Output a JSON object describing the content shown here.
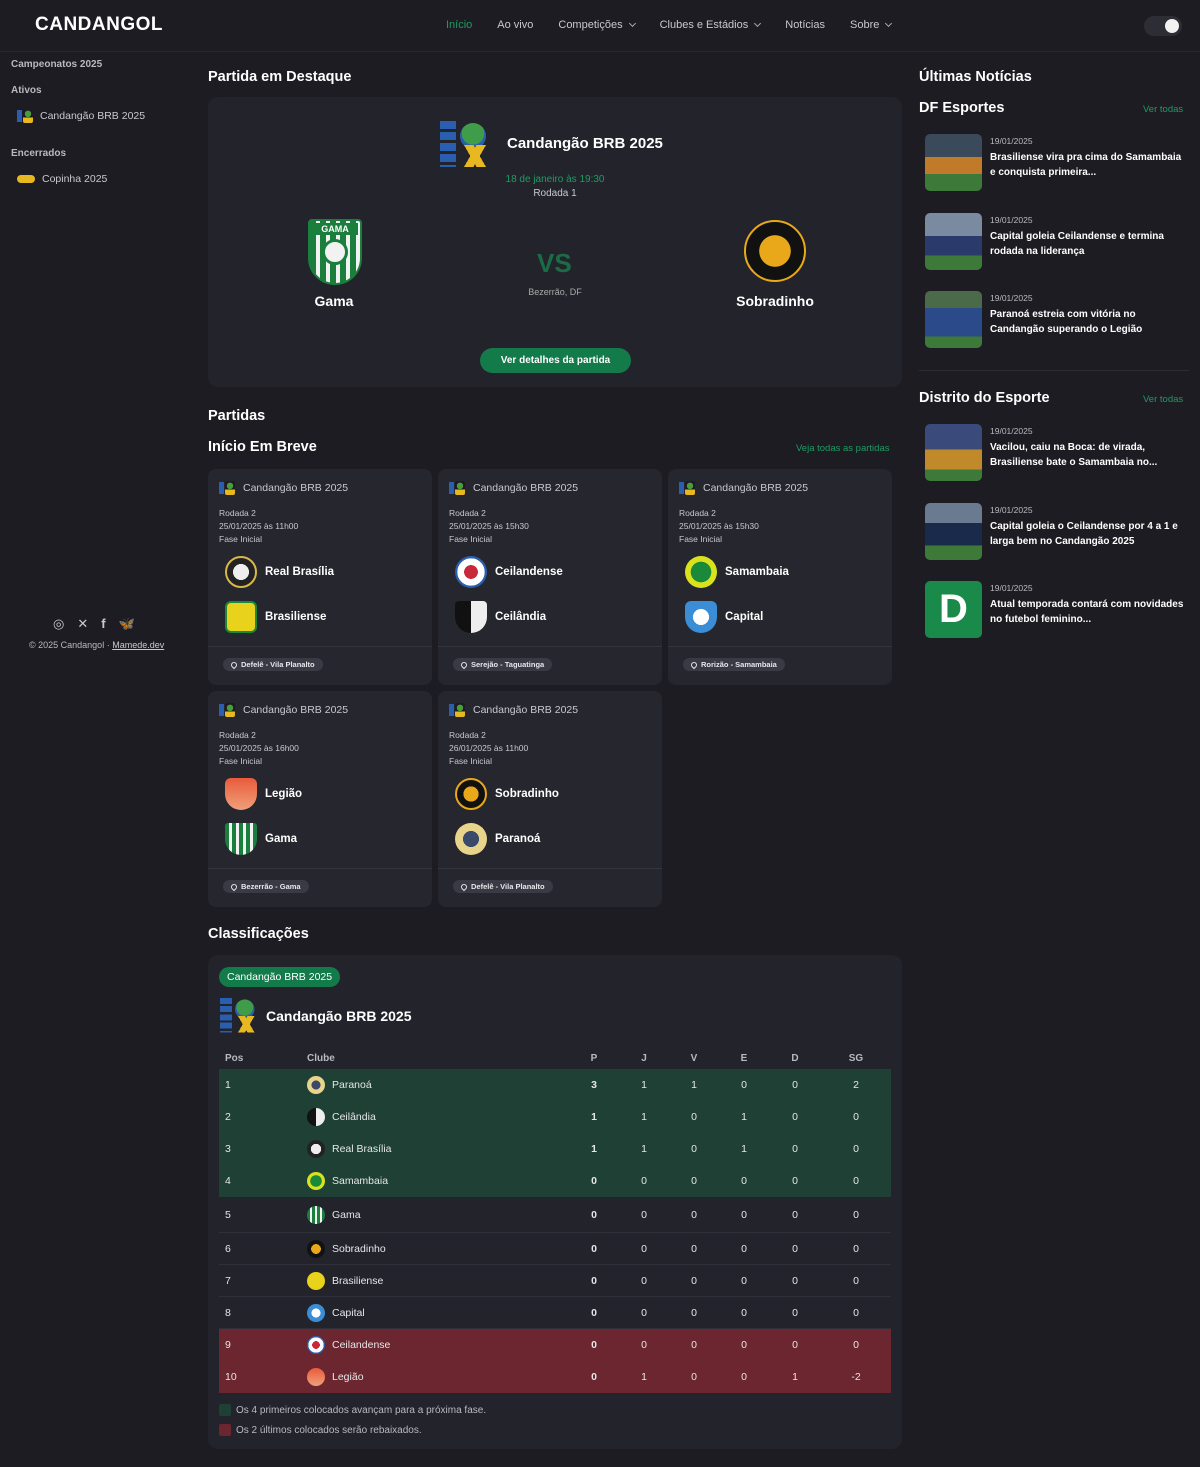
{
  "nav": {
    "logo": "CANDANGOL",
    "links": [
      "Início",
      "Ao vivo",
      "Competições",
      "Clubes e Estádios",
      "Notícias",
      "Sobre"
    ]
  },
  "sidebar": {
    "section": "Campeonatos 2025",
    "active_label": "Ativos",
    "active_items": [
      "Candangão BRB 2025"
    ],
    "closed_label": "Encerrados",
    "closed_items": [
      "Copinha 2025"
    ],
    "copyright": "© 2025 Candangol · ",
    "copyright_link": "Mamede.dev"
  },
  "featured": {
    "heading": "Partida em Destaque",
    "competition": "Candangão BRB 2025",
    "date": "18 de janeiro às 19:30",
    "round": "Rodada 1",
    "home": "Gama",
    "away": "Sobradinho",
    "vs": "VS",
    "venue": "Bezerrão, DF",
    "button": "Ver detalhes da partida"
  },
  "matches": {
    "heading": "Partidas",
    "subheading": "Início Em Breve",
    "see_all": "Veja todas as partidas",
    "cards": [
      {
        "competition": "Candangão BRB 2025",
        "round": "Rodada 2",
        "datetime": "25/01/2025 às 11h00",
        "phase": "Fase Inicial",
        "home": "Real Brasília",
        "away": "Brasiliense",
        "venue": "Defelê - Vila Planalto"
      },
      {
        "competition": "Candangão BRB 2025",
        "round": "Rodada 2",
        "datetime": "25/01/2025 às 15h30",
        "phase": "Fase Inicial",
        "home": "Ceilandense",
        "away": "Ceilândia",
        "venue": "Serejão - Taguatinga"
      },
      {
        "competition": "Candangão BRB 2025",
        "round": "Rodada 2",
        "datetime": "25/01/2025 às 15h30",
        "phase": "Fase Inicial",
        "home": "Samambaia",
        "away": "Capital",
        "venue": "Rorizão - Samambaia"
      },
      {
        "competition": "Candangão BRB 2025",
        "round": "Rodada 2",
        "datetime": "25/01/2025 às 16h00",
        "phase": "Fase Inicial",
        "home": "Legião",
        "away": "Gama",
        "venue": "Bezerrão - Gama"
      },
      {
        "competition": "Candangão BRB 2025",
        "round": "Rodada 2",
        "datetime": "26/01/2025 às 11h00",
        "phase": "Fase Inicial",
        "home": "Sobradinho",
        "away": "Paranoá",
        "venue": "Defelê - Vila Planalto"
      }
    ]
  },
  "standings": {
    "heading": "Classificações",
    "pill": "Candangão BRB 2025",
    "title": "Candangão BRB 2025",
    "columns": [
      "Pos",
      "Clube",
      "P",
      "J",
      "V",
      "E",
      "D",
      "SG"
    ],
    "rows": [
      {
        "pos": "1",
        "club": "Paranoá",
        "p": "3",
        "j": "1",
        "v": "1",
        "e": "0",
        "d": "0",
        "sg": "2"
      },
      {
        "pos": "2",
        "club": "Ceilândia",
        "p": "1",
        "j": "1",
        "v": "0",
        "e": "1",
        "d": "0",
        "sg": "0"
      },
      {
        "pos": "3",
        "club": "Real Brasília",
        "p": "1",
        "j": "1",
        "v": "0",
        "e": "1",
        "d": "0",
        "sg": "0"
      },
      {
        "pos": "4",
        "club": "Samambaia",
        "p": "0",
        "j": "0",
        "v": "0",
        "e": "0",
        "d": "0",
        "sg": "0"
      },
      {
        "pos": "5",
        "club": "Gama",
        "p": "0",
        "j": "0",
        "v": "0",
        "e": "0",
        "d": "0",
        "sg": "0"
      },
      {
        "pos": "6",
        "club": "Sobradinho",
        "p": "0",
        "j": "0",
        "v": "0",
        "e": "0",
        "d": "0",
        "sg": "0"
      },
      {
        "pos": "7",
        "club": "Brasiliense",
        "p": "0",
        "j": "0",
        "v": "0",
        "e": "0",
        "d": "0",
        "sg": "0"
      },
      {
        "pos": "8",
        "club": "Capital",
        "p": "0",
        "j": "0",
        "v": "0",
        "e": "0",
        "d": "0",
        "sg": "0"
      },
      {
        "pos": "9",
        "club": "Ceilandense",
        "p": "0",
        "j": "0",
        "v": "0",
        "e": "0",
        "d": "0",
        "sg": "0"
      },
      {
        "pos": "10",
        "club": "Legião",
        "p": "0",
        "j": "1",
        "v": "0",
        "e": "0",
        "d": "1",
        "sg": "-2"
      }
    ],
    "legend_advance": "Os 4 primeiros colocados avançam para a próxima fase.",
    "legend_relegate": "Os 2 últimos colocados serão rebaixados.",
    "colors": {
      "advance": "#1f4034",
      "relegate": "#6b2630"
    }
  },
  "news": {
    "heading": "Últimas Notícias",
    "see_all": "Ver todas",
    "sources": [
      {
        "name": "DF Esportes",
        "items": [
          {
            "date": "19/01/2025",
            "title": "Brasiliense vira pra cima do Samambaia e conquista primeira..."
          },
          {
            "date": "19/01/2025",
            "title": "Capital goleia Ceilandense e termina rodada na liderança"
          },
          {
            "date": "19/01/2025",
            "title": "Paranoá estreia com vitória no Candangão superando o Legião"
          }
        ]
      },
      {
        "name": "Distrito do Esporte",
        "items": [
          {
            "date": "19/01/2025",
            "title": "Vacilou, caiu na Boca: de virada, Brasiliense bate o Samambaia no..."
          },
          {
            "date": "19/01/2025",
            "title": "Capital goleia o Ceilandense por 4 a 1 e larga bem no Candangão 2025"
          },
          {
            "date": "19/01/2025",
            "title": "Atual temporada contará com novidades no futebol feminino..."
          }
        ]
      }
    ]
  },
  "colors": {
    "accent": "#1e9c62",
    "button": "#137a4a",
    "background": "#1c1c22",
    "card": "#26262e"
  }
}
